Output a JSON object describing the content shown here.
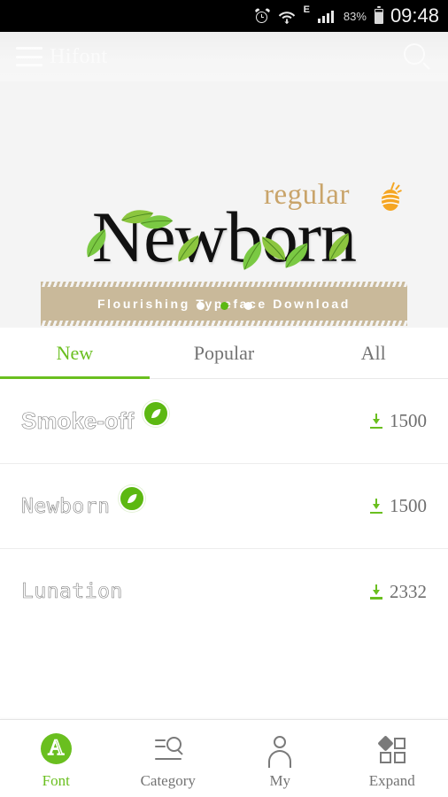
{
  "statusbar": {
    "alarm_icon": "alarm-clock-icon",
    "wifi_icon": "wifi-icon",
    "network_label": "E",
    "signal_icon": "cellular-signal-icon",
    "battery_percent": "83%",
    "battery_icon": "battery-icon",
    "clock": "09:48"
  },
  "appbar": {
    "menu_icon": "hamburger-menu-icon",
    "title": "Hifont",
    "search_icon": "search-icon"
  },
  "banner": {
    "regular_word": "regular",
    "main_word": "Newborn",
    "tagline": "Flourishing  Typeface  Download",
    "seed_icon": "seed-icon",
    "leaf_icon": "leaf-icon",
    "dots": [
      {
        "active": false
      },
      {
        "active": true
      },
      {
        "active": false
      }
    ],
    "accent_green": "#5cb811",
    "accent_tan": "#c9a46a",
    "brush_color": "#c9b99a"
  },
  "tabs": [
    {
      "label": "New",
      "active": true
    },
    {
      "label": "Popular",
      "active": false
    },
    {
      "label": "All",
      "active": false
    }
  ],
  "list": [
    {
      "name": "Smoke-off",
      "badge": true,
      "badge_icon": "leaf-badge-icon",
      "downloads": "1500",
      "download_icon": "download-icon"
    },
    {
      "name": "Newborn",
      "badge": true,
      "badge_icon": "leaf-badge-icon",
      "downloads": "1500",
      "download_icon": "download-icon"
    },
    {
      "name": "Lunation",
      "badge": false,
      "badge_icon": "",
      "downloads": "2332",
      "download_icon": "download-icon"
    }
  ],
  "bottomnav": [
    {
      "label": "Font",
      "icon": "font-circle-a-icon",
      "active": true
    },
    {
      "label": "Category",
      "icon": "category-search-icon",
      "active": false
    },
    {
      "label": "My",
      "icon": "person-icon",
      "active": false
    },
    {
      "label": "Expand",
      "icon": "grid-expand-icon",
      "active": false
    }
  ]
}
